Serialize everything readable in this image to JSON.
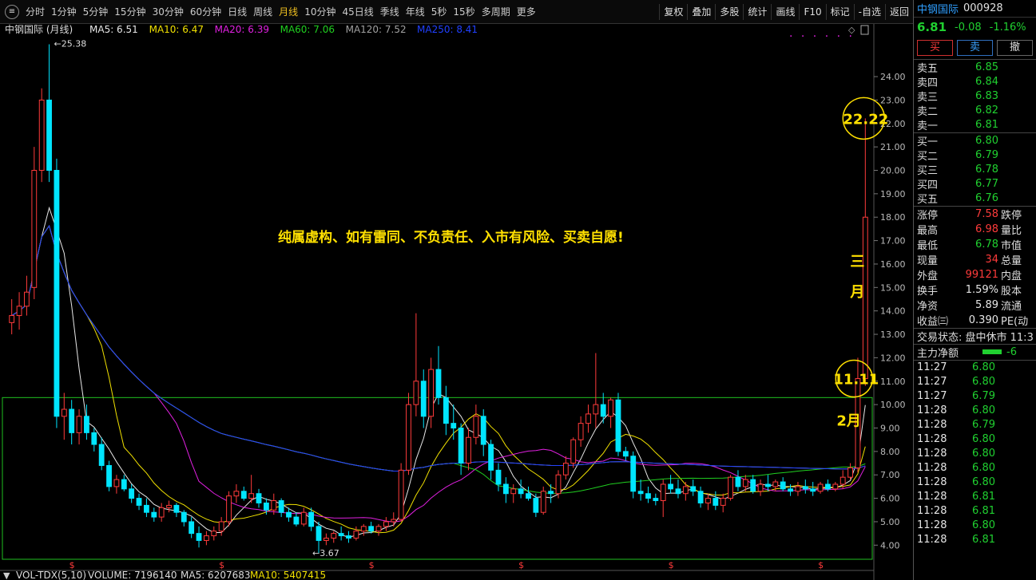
{
  "toolbar": {
    "periods": [
      "分时",
      "1分钟",
      "5分钟",
      "15分钟",
      "30分钟",
      "60分钟",
      "日线",
      "周线",
      "月线",
      "10分钟",
      "45日线",
      "季线",
      "年线",
      "5秒",
      "15秒",
      "多周期",
      "更多"
    ],
    "active_period": "月线",
    "tools": [
      "复权",
      "叠加",
      "多股",
      "统计",
      "画线",
      "F10",
      "标记",
      "-自选",
      "返回"
    ]
  },
  "stock": {
    "name": "中钢国际",
    "code": "000928",
    "price": "6.81",
    "change": "-0.08",
    "change_pct": "-1.16%"
  },
  "trade_buttons": [
    "买",
    "卖",
    "撤"
  ],
  "order_book": {
    "sells": [
      {
        "label": "卖五",
        "price": "6.85"
      },
      {
        "label": "卖四",
        "price": "6.84"
      },
      {
        "label": "卖三",
        "price": "6.83"
      },
      {
        "label": "卖二",
        "price": "6.82"
      },
      {
        "label": "卖一",
        "price": "6.81"
      }
    ],
    "buys": [
      {
        "label": "买一",
        "price": "6.80"
      },
      {
        "label": "买二",
        "price": "6.79"
      },
      {
        "label": "买三",
        "price": "6.78"
      },
      {
        "label": "买四",
        "price": "6.77"
      },
      {
        "label": "买五",
        "price": "6.76"
      }
    ]
  },
  "stats": [
    {
      "label": "涨停",
      "value": "7.58",
      "label2": "跌停",
      "color": "#ff3b3b"
    },
    {
      "label": "最高",
      "value": "6.98",
      "label2": "量比",
      "color": "#ff3b3b"
    },
    {
      "label": "最低",
      "value": "6.78",
      "label2": "市值",
      "color": "#20d030"
    },
    {
      "label": "现量",
      "value": "34",
      "label2": "总量",
      "color": "#ff3b3b"
    },
    {
      "label": "外盘",
      "value": "99121",
      "label2": "内盘",
      "color": "#ff3b3b"
    },
    {
      "label": "换手",
      "value": "1.59%",
      "label2": "股本",
      "color": "#e6e6e6"
    },
    {
      "label": "净资",
      "value": "5.89",
      "label2": "流通",
      "color": "#e6e6e6"
    },
    {
      "label": "收益㈢",
      "value": "0.390",
      "label2": "PE(动",
      "color": "#e6e6e6"
    }
  ],
  "status": "交易状态: 盘中休市 11:3",
  "main_flow": {
    "label": "主力净额",
    "value": "-6"
  },
  "ticks": [
    {
      "time": "11:27",
      "price": "6.80"
    },
    {
      "time": "11:27",
      "price": "6.80"
    },
    {
      "time": "11:27",
      "price": "6.79"
    },
    {
      "time": "11:28",
      "price": "6.80"
    },
    {
      "time": "11:28",
      "price": "6.79"
    },
    {
      "time": "11:28",
      "price": "6.80"
    },
    {
      "time": "11:28",
      "price": "6.80"
    },
    {
      "time": "11:28",
      "price": "6.80"
    },
    {
      "time": "11:28",
      "price": "6.80"
    },
    {
      "time": "11:28",
      "price": "6.81"
    },
    {
      "time": "11:28",
      "price": "6.81"
    },
    {
      "time": "11:28",
      "price": "6.80"
    },
    {
      "time": "11:28",
      "price": "6.81"
    }
  ],
  "colors": {
    "up": "#ff3b3b",
    "down": "#00e5ff",
    "ma5": "#e8e8e8",
    "ma10": "#f0e000",
    "ma20": "#e020e0",
    "ma60": "#20d020",
    "ma120": "#a0a0a0",
    "ma250": "#2040ff",
    "annotation": "#ffe000"
  },
  "chart_data": {
    "type": "candlestick",
    "title": "中钢国际 (月线)",
    "ma_legend": [
      {
        "name": "MA5",
        "value": "6.51",
        "color": "#e8e8e8"
      },
      {
        "name": "MA10",
        "value": "6.47",
        "color": "#f0e000"
      },
      {
        "name": "MA20",
        "value": "6.39",
        "color": "#e020e0"
      },
      {
        "name": "MA60",
        "value": "7.06",
        "color": "#20d020"
      },
      {
        "name": "MA120",
        "value": "7.52",
        "color": "#a0a0a0"
      },
      {
        "name": "MA250",
        "value": "8.41",
        "color": "#2040ff"
      }
    ],
    "y_ticks": [
      "24.00",
      "23.00",
      "22.00",
      "21.00",
      "20.00",
      "19.00",
      "18.00",
      "17.00",
      "16.00",
      "15.00",
      "14.00",
      "13.00",
      "12.00",
      "11.00",
      "10.00",
      "9.00",
      "8.00",
      "7.00",
      "6.00",
      "5.00",
      "4.00"
    ],
    "ylim": [
      3.5,
      25.5
    ],
    "candles": [
      [
        13.5,
        14.5,
        13.0,
        13.8
      ],
      [
        13.8,
        14.8,
        13.2,
        14.2
      ],
      [
        14.2,
        15.5,
        13.8,
        14.8
      ],
      [
        15.0,
        21.0,
        14.5,
        20.0
      ],
      [
        20.0,
        23.5,
        19.5,
        23.0
      ],
      [
        23.0,
        25.38,
        19.5,
        20.0
      ],
      [
        20.0,
        20.5,
        9.0,
        9.5
      ],
      [
        9.5,
        10.5,
        8.5,
        9.8
      ],
      [
        9.8,
        10.2,
        8.3,
        8.8
      ],
      [
        8.8,
        9.8,
        8.3,
        9.5
      ],
      [
        9.5,
        10.0,
        8.5,
        8.8
      ],
      [
        8.8,
        9.0,
        8.0,
        8.3
      ],
      [
        8.3,
        8.6,
        7.2,
        7.4
      ],
      [
        7.4,
        7.6,
        6.3,
        6.5
      ],
      [
        6.5,
        7.0,
        6.2,
        6.8
      ],
      [
        6.8,
        7.0,
        6.3,
        6.4
      ],
      [
        6.4,
        6.6,
        5.8,
        6.0
      ],
      [
        6.0,
        6.2,
        5.5,
        5.7
      ],
      [
        5.7,
        6.0,
        5.2,
        5.4
      ],
      [
        5.4,
        5.6,
        5.0,
        5.2
      ],
      [
        5.2,
        5.8,
        5.0,
        5.6
      ],
      [
        5.6,
        5.9,
        5.4,
        5.7
      ],
      [
        5.7,
        5.8,
        5.2,
        5.4
      ],
      [
        5.4,
        5.5,
        4.8,
        5.0
      ],
      [
        5.0,
        5.2,
        4.3,
        4.5
      ],
      [
        4.5,
        4.8,
        3.9,
        4.2
      ],
      [
        4.2,
        4.6,
        4.0,
        4.4
      ],
      [
        4.4,
        4.8,
        4.2,
        4.6
      ],
      [
        4.6,
        5.2,
        4.4,
        5.0
      ],
      [
        5.0,
        6.3,
        4.8,
        6.1
      ],
      [
        6.1,
        6.6,
        5.8,
        6.3
      ],
      [
        6.3,
        6.5,
        5.9,
        6.0
      ],
      [
        6.0,
        7.0,
        5.8,
        6.2
      ],
      [
        6.2,
        6.4,
        5.6,
        5.8
      ],
      [
        5.8,
        6.0,
        5.3,
        5.5
      ],
      [
        5.5,
        6.2,
        5.3,
        5.9
      ],
      [
        5.9,
        6.0,
        5.2,
        5.4
      ],
      [
        5.4,
        5.6,
        5.0,
        5.2
      ],
      [
        5.2,
        5.4,
        4.8,
        4.9
      ],
      [
        4.9,
        5.6,
        4.8,
        5.4
      ],
      [
        5.4,
        5.6,
        4.6,
        4.8
      ],
      [
        4.8,
        5.0,
        3.67,
        4.2
      ],
      [
        4.2,
        4.5,
        4.0,
        4.3
      ],
      [
        4.3,
        4.6,
        4.1,
        4.5
      ],
      [
        4.5,
        4.8,
        4.2,
        4.4
      ],
      [
        4.4,
        4.6,
        4.1,
        4.3
      ],
      [
        4.3,
        4.8,
        4.2,
        4.6
      ],
      [
        4.6,
        4.9,
        4.4,
        4.8
      ],
      [
        4.8,
        5.0,
        4.5,
        4.6
      ],
      [
        4.6,
        4.9,
        4.4,
        4.8
      ],
      [
        4.8,
        5.2,
        4.6,
        5.0
      ],
      [
        5.0,
        5.4,
        4.8,
        5.1
      ],
      [
        5.1,
        7.5,
        5.0,
        7.2
      ],
      [
        7.2,
        10.5,
        7.0,
        10.0
      ],
      [
        10.0,
        13.9,
        9.5,
        11.0
      ],
      [
        11.0,
        11.5,
        9.0,
        9.5
      ],
      [
        9.5,
        12.0,
        9.0,
        11.5
      ],
      [
        11.5,
        12.5,
        10.0,
        10.3
      ],
      [
        10.3,
        10.8,
        8.7,
        9.2
      ],
      [
        9.2,
        10.0,
        8.5,
        9.0
      ],
      [
        9.0,
        9.2,
        7.0,
        7.5
      ],
      [
        7.5,
        9.0,
        7.2,
        8.6
      ],
      [
        8.6,
        10.0,
        8.3,
        9.5
      ],
      [
        9.5,
        9.8,
        7.8,
        8.3
      ],
      [
        8.3,
        8.5,
        6.8,
        7.2
      ],
      [
        7.2,
        7.5,
        6.3,
        6.6
      ],
      [
        6.6,
        6.9,
        5.8,
        6.2
      ],
      [
        6.2,
        6.6,
        5.8,
        6.4
      ],
      [
        6.4,
        6.8,
        6.0,
        6.2
      ],
      [
        6.2,
        6.5,
        5.9,
        6.0
      ],
      [
        6.0,
        6.2,
        5.2,
        5.4
      ],
      [
        5.4,
        6.5,
        5.3,
        6.3
      ],
      [
        6.3,
        6.6,
        5.8,
        6.2
      ],
      [
        6.2,
        7.2,
        6.0,
        7.0
      ],
      [
        7.0,
        7.8,
        6.8,
        7.5
      ],
      [
        7.5,
        8.6,
        7.3,
        8.5
      ],
      [
        8.5,
        9.5,
        8.2,
        9.2
      ],
      [
        9.2,
        10.0,
        8.8,
        9.6
      ],
      [
        9.6,
        12.2,
        9.0,
        10.0
      ],
      [
        10.0,
        10.5,
        9.2,
        9.5
      ],
      [
        9.5,
        10.3,
        9.0,
        10.2
      ],
      [
        10.2,
        10.5,
        7.8,
        8.0
      ],
      [
        8.0,
        8.2,
        7.6,
        7.8
      ],
      [
        7.8,
        8.0,
        6.0,
        6.3
      ],
      [
        6.3,
        6.8,
        5.9,
        6.2
      ],
      [
        6.2,
        6.5,
        5.8,
        6.0
      ],
      [
        6.0,
        6.2,
        5.7,
        5.9
      ],
      [
        5.9,
        6.8,
        5.2,
        6.6
      ],
      [
        6.6,
        7.0,
        6.2,
        6.4
      ],
      [
        6.4,
        6.8,
        6.0,
        6.2
      ],
      [
        6.2,
        6.7,
        5.9,
        6.5
      ],
      [
        6.5,
        6.8,
        6.1,
        6.3
      ],
      [
        6.3,
        6.5,
        5.6,
        5.8
      ],
      [
        5.8,
        6.2,
        5.5,
        6.0
      ],
      [
        6.0,
        6.3,
        5.5,
        5.7
      ],
      [
        5.7,
        6.2,
        5.4,
        6.0
      ],
      [
        6.0,
        7.0,
        5.9,
        6.9
      ],
      [
        6.9,
        7.2,
        6.3,
        6.5
      ],
      [
        6.5,
        7.0,
        6.3,
        6.8
      ],
      [
        6.8,
        7.0,
        6.2,
        6.3
      ],
      [
        6.3,
        6.8,
        6.1,
        6.6
      ],
      [
        6.6,
        7.0,
        6.3,
        6.5
      ],
      [
        6.5,
        6.8,
        6.3,
        6.7
      ],
      [
        6.7,
        6.9,
        6.3,
        6.4
      ],
      [
        6.4,
        6.6,
        6.1,
        6.3
      ],
      [
        6.3,
        6.7,
        6.1,
        6.5
      ],
      [
        6.5,
        6.8,
        6.2,
        6.4
      ],
      [
        6.4,
        6.7,
        6.1,
        6.3
      ],
      [
        6.3,
        6.7,
        6.2,
        6.6
      ],
      [
        6.6,
        6.8,
        6.3,
        6.4
      ],
      [
        6.4,
        6.7,
        6.3,
        6.6
      ],
      [
        6.6,
        7.2,
        6.4,
        6.9
      ],
      [
        6.9,
        7.5,
        6.8,
        7.3
      ],
      [
        7.3,
        12.0,
        7.1,
        11.11
      ],
      [
        11.11,
        22.22,
        10.8,
        18.0
      ]
    ],
    "annotations": {
      "high_label": "25.38",
      "low_label": "3.67",
      "disclaimer": "纯属虚构、如有雷同、不负责任、入市有风险、买卖自愿!",
      "circle_top": "22.22",
      "circle_mid": "11.11",
      "march_label": "三月",
      "feb_label": "2月"
    },
    "volume_legend": {
      "name": "VOL-TDX(5,10)",
      "volume": "VOLUME: 7196140",
      "ma5": "MA5: 6207683",
      "ma10": "MA10: 5407415"
    }
  }
}
